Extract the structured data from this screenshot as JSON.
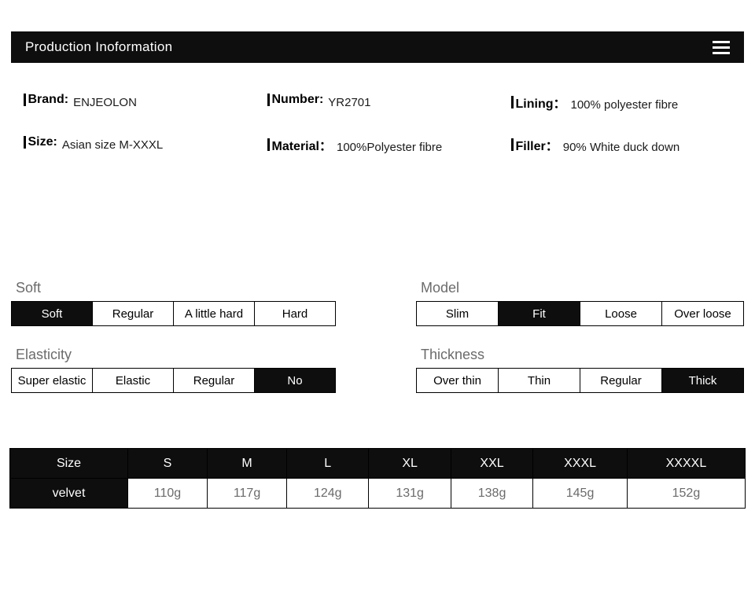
{
  "header": {
    "title": "Production Inoformation"
  },
  "info": {
    "brand_label": "Brand:",
    "brand_value": "ENJEOLON",
    "number_label": "Number:",
    "number_value": "YR2701",
    "lining_label": "Lining：",
    "lining_value": "100% polyester fibre",
    "size_label": "Size:",
    "size_value": "Asian size M-XXXL",
    "material_label": "Material：",
    "material_value": "100%Polyester fibre",
    "filler_label": "Filler：",
    "filler_value": "90% White duck down"
  },
  "props": {
    "soft": {
      "label": "Soft",
      "opts": [
        "Soft",
        "Regular",
        "A little hard",
        "Hard"
      ],
      "sel": 0
    },
    "model": {
      "label": "Model",
      "opts": [
        "Slim",
        "Fit",
        "Loose",
        "Over loose"
      ],
      "sel": 1
    },
    "elasticity": {
      "label": "Elasticity",
      "opts": [
        "Super elastic",
        "Elastic",
        "Regular",
        "No"
      ],
      "sel": 3
    },
    "thickness": {
      "label": "Thickness",
      "opts": [
        "Over thin",
        "Thin",
        "Regular",
        "Thick"
      ],
      "sel": 3
    }
  },
  "size_table": {
    "header": [
      "Size",
      "S",
      "M",
      "L",
      "XL",
      "XXL",
      "XXXL",
      "XXXXL"
    ],
    "rows": [
      {
        "label": "velvet",
        "cells": [
          "110g",
          "117g",
          "124g",
          "131g",
          "138g",
          "145g",
          "152g"
        ]
      }
    ]
  }
}
